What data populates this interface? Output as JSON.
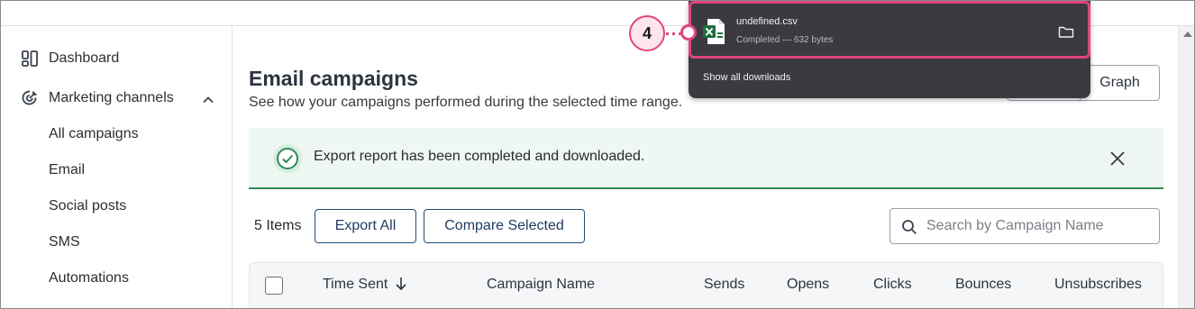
{
  "sidebar": {
    "dashboard_label": "Dashboard",
    "marketing_label": "Marketing channels",
    "sub_items": [
      "All campaigns",
      "Email",
      "Social posts",
      "SMS",
      "Automations"
    ]
  },
  "main": {
    "title": "Email campaigns",
    "subtitle": "See how your campaigns performed during the selected time range.",
    "view_toggle": {
      "graph_label": "Graph"
    },
    "alert": {
      "message": "Export report has been completed and downloaded."
    },
    "toolbar": {
      "items_count": "5 Items",
      "export_label": "Export All",
      "compare_label": "Compare Selected",
      "search_placeholder": "Search by Campaign Name"
    },
    "table": {
      "columns": [
        "Time Sent",
        "Campaign Name",
        "Sends",
        "Opens",
        "Clicks",
        "Bounces",
        "Unsubscribes"
      ]
    }
  },
  "download": {
    "filename": "undefined.csv",
    "status": "Completed — 632 bytes",
    "show_all_label": "Show all downloads"
  },
  "callout": {
    "step_number": "4"
  },
  "colors": {
    "accent_pink": "#e0457b",
    "success_green": "#2e8b57",
    "button_navy": "#1f4e79",
    "popup_bg": "#3b3a40"
  }
}
